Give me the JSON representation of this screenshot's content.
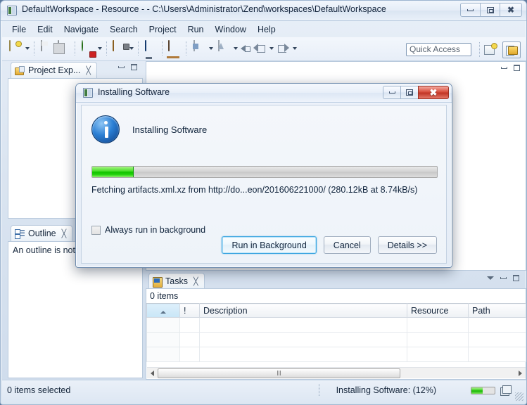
{
  "window": {
    "title": "DefaultWorkspace - Resource -  - C:\\Users\\Administrator\\Zend\\workspaces\\DefaultWorkspace",
    "minimize_label": "Minimize",
    "maximize_label": "Maximize",
    "close_label": "Close"
  },
  "menu": {
    "items": [
      {
        "label": "File"
      },
      {
        "label": "Edit"
      },
      {
        "label": "Navigate"
      },
      {
        "label": "Search"
      },
      {
        "label": "Project"
      },
      {
        "label": "Run"
      },
      {
        "label": "Window"
      },
      {
        "label": "Help"
      }
    ]
  },
  "toolbar": {
    "icons": [
      "new-document-icon",
      "save-icon",
      "save-all-icon",
      "run-icon",
      "debug-icon",
      "open-console-icon",
      "open-library-icon",
      "export-icon",
      "import-icon",
      "back-icon",
      "previous-icon",
      "forward-icon"
    ],
    "quick_access_placeholder": "Quick Access",
    "quick_access_value": "",
    "new_perspective_label": "Open Perspective",
    "resource_perspective_label": "Resource"
  },
  "left_panel": {
    "project_explorer": {
      "tab_label": "Project Exp...",
      "close_label": "╳"
    },
    "outline": {
      "tab_label": "Outline",
      "close_label": "╳",
      "message": "An outline is not"
    }
  },
  "tasks": {
    "tab_label": "Tasks",
    "close_label": "╳",
    "item_count": "0 items",
    "columns": [
      {
        "label": "",
        "name": "sort-column"
      },
      {
        "label": "!",
        "name": "priority-column"
      },
      {
        "label": "Description",
        "name": "description-column"
      },
      {
        "label": "Resource",
        "name": "resource-column"
      },
      {
        "label": "Path",
        "name": "path-column"
      }
    ],
    "rows": []
  },
  "status_bar": {
    "selection_text": "0 items selected",
    "progress_text": "Installing Software: (12%)",
    "progress_percent": 12
  },
  "dialog": {
    "title": "Installing Software",
    "heading": "Installing Software",
    "progress_percent": 12,
    "message": "Fetching artifacts.xml.xz from http://do...eon/201606221000/ (280.12kB at 8.74kB/s)",
    "checkbox_label": "Always run in background",
    "checkbox_checked": false,
    "buttons": [
      {
        "label": "Run in Background",
        "name": "run-in-background-button",
        "default": true
      },
      {
        "label": "Cancel",
        "name": "cancel-button",
        "default": false
      },
      {
        "label": "Details >>",
        "name": "details-button",
        "default": false
      }
    ]
  },
  "colors": {
    "progress_green": "#10c200",
    "accent_blue": "#3aa5e0",
    "close_red": "#c03525"
  }
}
